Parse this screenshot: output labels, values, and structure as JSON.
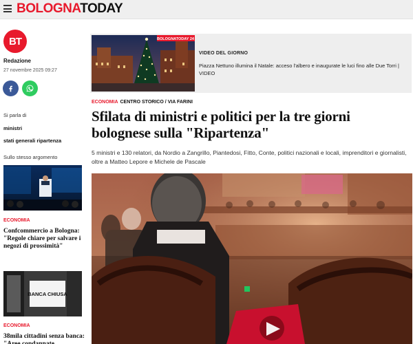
{
  "header": {
    "logo_part1": "BOLOGNA",
    "logo_part2": "TODAY"
  },
  "author": {
    "badge": "BT",
    "name": "Redazione",
    "date": "27 novembre 2025 09:27"
  },
  "share": {
    "facebook_icon": "facebook-icon",
    "whatsapp_icon": "whatsapp-icon"
  },
  "sidebar": {
    "topics_label": "Si parla di",
    "topics": [
      "ministri",
      "stati generali ripartenza"
    ],
    "related_label": "Sullo stesso argomento",
    "related": [
      {
        "category": "ECONOMIA",
        "title": "Confcommercio a Bologna: \"Regole chiare per salvare i negozi di prossimità\""
      },
      {
        "category": "ECONOMIA",
        "title": "38mila cittadini senza banca: \"Aree condannate",
        "thumb_sign": "BANCA CHIUSA"
      }
    ]
  },
  "video": {
    "label": "VIDEO DEL GIORNO",
    "title": "Piazza Nettuno illumina il Natale: acceso l'albero e inaugurate le luci fino alle Due Torri | VIDEO",
    "badge": "BOLOGNATODAY 24"
  },
  "article": {
    "category": "ECONOMIA",
    "section": "CENTRO STORICO / VIA FARINI",
    "headline": "Sfilata di ministri e politici per la tre giorni bolognese sulla \"Ripartenza\"",
    "lead": "5 ministri e 130 relatori, da Nordio a Zangrillo, Piantedosi, Fitto, Conte, politici nazionali e locali, imprenditori e giornalisti, oltre a Matteo Lepore e Michele de Pascale"
  },
  "colors": {
    "brand_red": "#e8192c",
    "facebook": "#3b5998",
    "whatsapp": "#2fcc60"
  }
}
